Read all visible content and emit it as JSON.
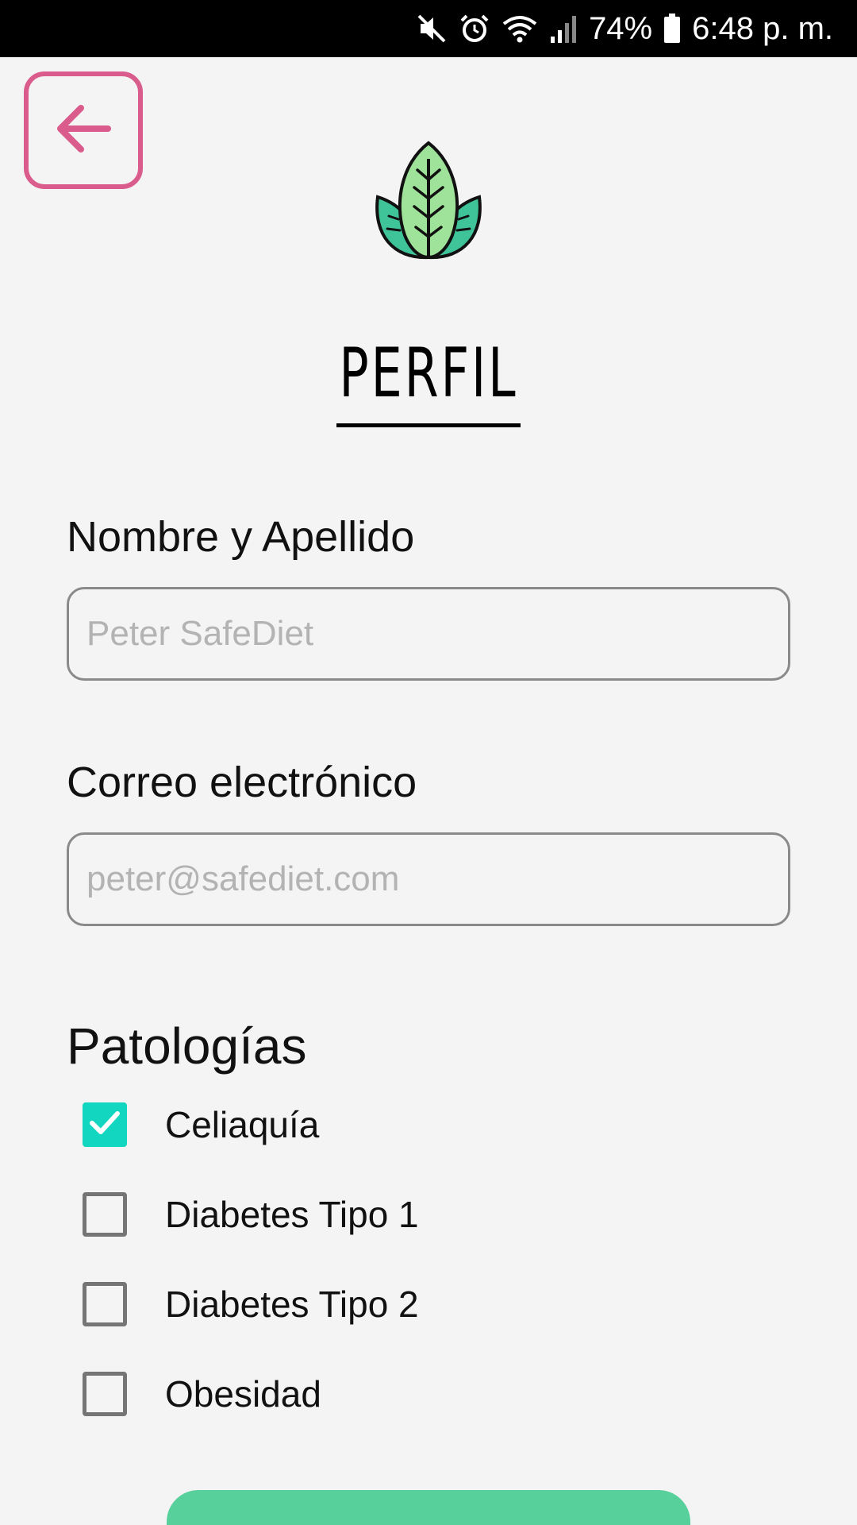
{
  "status_bar": {
    "battery": "74%",
    "time": "6:48 p. m.",
    "icons": [
      "mute-icon",
      "alarm-icon",
      "wifi-icon",
      "signal-icon",
      "battery-icon"
    ]
  },
  "header": {
    "back_icon": "arrow-left-icon",
    "logo_icon": "leaf-logo-icon",
    "title": "PERFIL"
  },
  "form": {
    "name_label": "Nombre y Apellido",
    "name_placeholder": "Peter SafeDiet",
    "name_value": "",
    "email_label": "Correo electrónico",
    "email_placeholder": "peter@safediet.com",
    "email_value": ""
  },
  "pathologies": {
    "title": "Patologías",
    "items": [
      {
        "label": "Celiaquía",
        "checked": true
      },
      {
        "label": "Diabetes Tipo 1",
        "checked": false
      },
      {
        "label": "Diabetes Tipo 2",
        "checked": false
      },
      {
        "label": "Obesidad",
        "checked": false
      }
    ]
  },
  "colors": {
    "accent_pink": "#d95c8c",
    "check_teal": "#12d6c0",
    "button_green": "#57d09b",
    "background": "#f4f4f4"
  }
}
